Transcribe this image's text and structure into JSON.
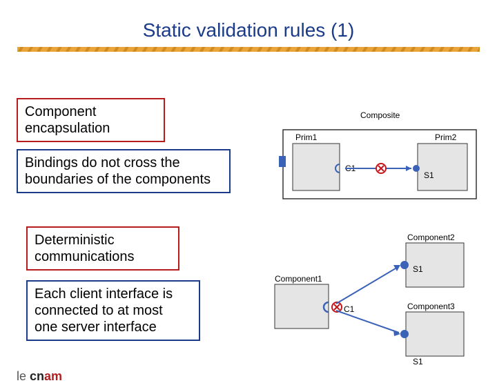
{
  "title": "Static validation rules (1)",
  "boxes": {
    "encapsulation_title": "Component\nencapsulation",
    "encapsulation_rule": "Bindings do not cross the\nboundaries of the components",
    "deterministic_title": "Deterministic\ncommunications",
    "deterministic_rule": "Each client interface is\nconnected to at most\none server interface"
  },
  "diagram1": {
    "composite_label": "Composite",
    "prim1_label": "Prim1",
    "prim2_label": "Prim2",
    "client_iface": "C1",
    "server_iface": "S1"
  },
  "diagram2": {
    "component1_label": "Component1",
    "component2_label": "Component2",
    "component3_label": "Component3",
    "client_iface": "C1",
    "server2_iface": "S1",
    "server3_iface": "S1"
  },
  "logo_text": "le cnam"
}
